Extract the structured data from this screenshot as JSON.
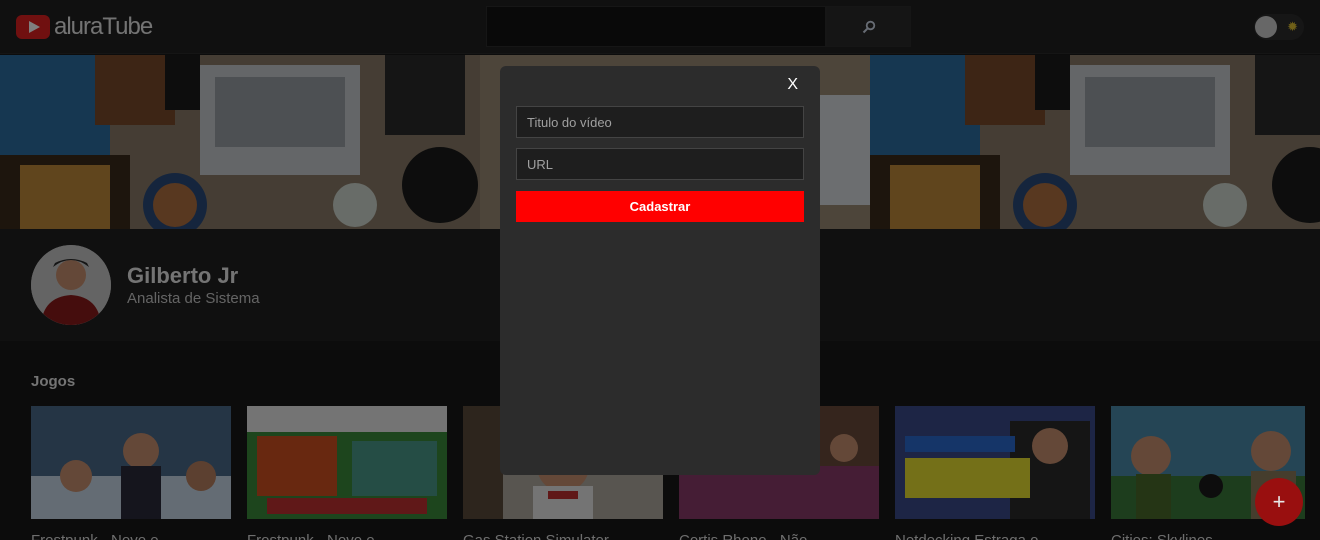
{
  "header": {
    "logo_text": "aluraTube",
    "search_value": "",
    "theme_toggle_icon": "sun-icon"
  },
  "profile": {
    "name": "Gilberto Jr",
    "role": "Analista de Sistema"
  },
  "timeline": {
    "section_title": "Jogos",
    "videos": [
      {
        "title": "Frostpunk - Novo e"
      },
      {
        "title": "Frostpunk - Novo e"
      },
      {
        "title": "Gas Station Simulator"
      },
      {
        "title": "Cortis Rhono - Não"
      },
      {
        "title": "Netdecking Estraga o"
      },
      {
        "title": "Cities: Skylines"
      }
    ]
  },
  "modal": {
    "close_label": "X",
    "title_placeholder": "Titulo do vídeo",
    "url_placeholder": "URL",
    "submit_label": "Cadastrar"
  },
  "fab": {
    "label": "+"
  },
  "colors": {
    "brand_red": "#ff0000",
    "background": "#181818",
    "modal_bg": "#2c2c2c"
  }
}
